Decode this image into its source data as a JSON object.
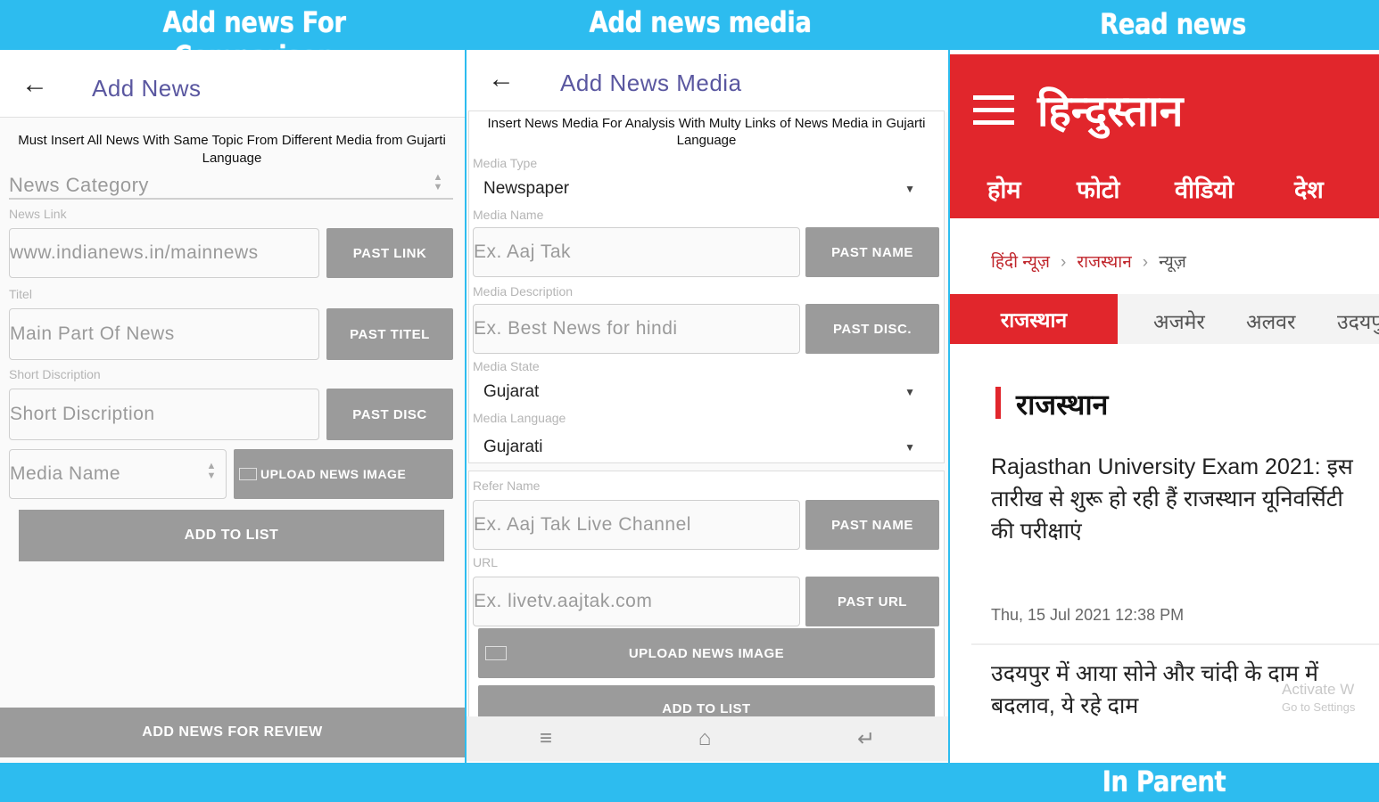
{
  "banners": {
    "left": "Add news For Comparison",
    "middle": "Add news media",
    "right": "Read news",
    "bottom": "In Parent website"
  },
  "panel1": {
    "title": "Add News",
    "note": "Must Insert All News With Same Topic From Different Media from Gujarti Language",
    "category_placeholder": "News Category",
    "link_label": "News Link",
    "link_value": "www.indianews.in/mainnews",
    "link_button": "PAST LINK",
    "title_label": "Titel",
    "title_placeholder": "Main Part Of News",
    "title_button": "PAST TITEL",
    "desc_label": "Short Discription",
    "desc_placeholder": "Short Discription",
    "desc_button": "PAST DISC",
    "media_placeholder": "Media Name",
    "upload_button": "UPLOAD NEWS IMAGE",
    "add_list_button": "ADD TO LIST",
    "review_button": "ADD NEWS FOR REVIEW"
  },
  "panel2": {
    "title": "Add News Media",
    "note": "Insert News Media For Analysis With Multy Links of News Media in Gujarti Language",
    "type_label": "Media Type",
    "type_value": "Newspaper",
    "name_label": "Media Name",
    "name_placeholder": "Ex. Aaj Tak",
    "name_button": "PAST NAME",
    "desc_label": "Media Description",
    "desc_placeholder": "Ex. Best News for hindi",
    "desc_button": "PAST DISC.",
    "state_label": "Media State",
    "state_value": "Gujarat",
    "lang_label": "Media Language",
    "lang_value": "Gujarati",
    "refer_label": "Refer Name",
    "refer_placeholder": "Ex. Aaj Tak Live Channel",
    "refer_button": "PAST NAME",
    "url_label": "URL",
    "url_placeholder": "Ex. livetv.aajtak.com",
    "url_button": "PAST URL",
    "upload_button": "UPLOAD NEWS IMAGE",
    "add_list_button": "ADD TO LIST"
  },
  "panel3": {
    "logo": "हिन्दुस्तान",
    "nav": [
      "होम",
      "फोटो",
      "वीडियो",
      "देश"
    ],
    "breadcrumb": [
      "हिंदी न्यूज़",
      "राजस्थान",
      "न्यूज़"
    ],
    "tabs": [
      "राजस्थान",
      "अजमेर",
      "अलवर",
      "उदयपुर"
    ],
    "section": "राजस्थान",
    "headline1": "Rajasthan University Exam 2021: इस तारीख से शुरू हो रही हैं राजस्थान यूनिवर्सिटी की परीक्षाएं",
    "date1": "Thu, 15 Jul 2021 12:38 PM",
    "headline2": "उदयपुर में आया सोने और चांदी के दाम में बदलाव, ये रहे दाम",
    "watermark1": "Activate W",
    "watermark2": "Go to Settings"
  },
  "colors": {
    "banner_blue": "#2dbcef",
    "brand_red": "#e1262c",
    "button_gray": "#9b9b9b",
    "title_purple": "#5a57a0"
  }
}
